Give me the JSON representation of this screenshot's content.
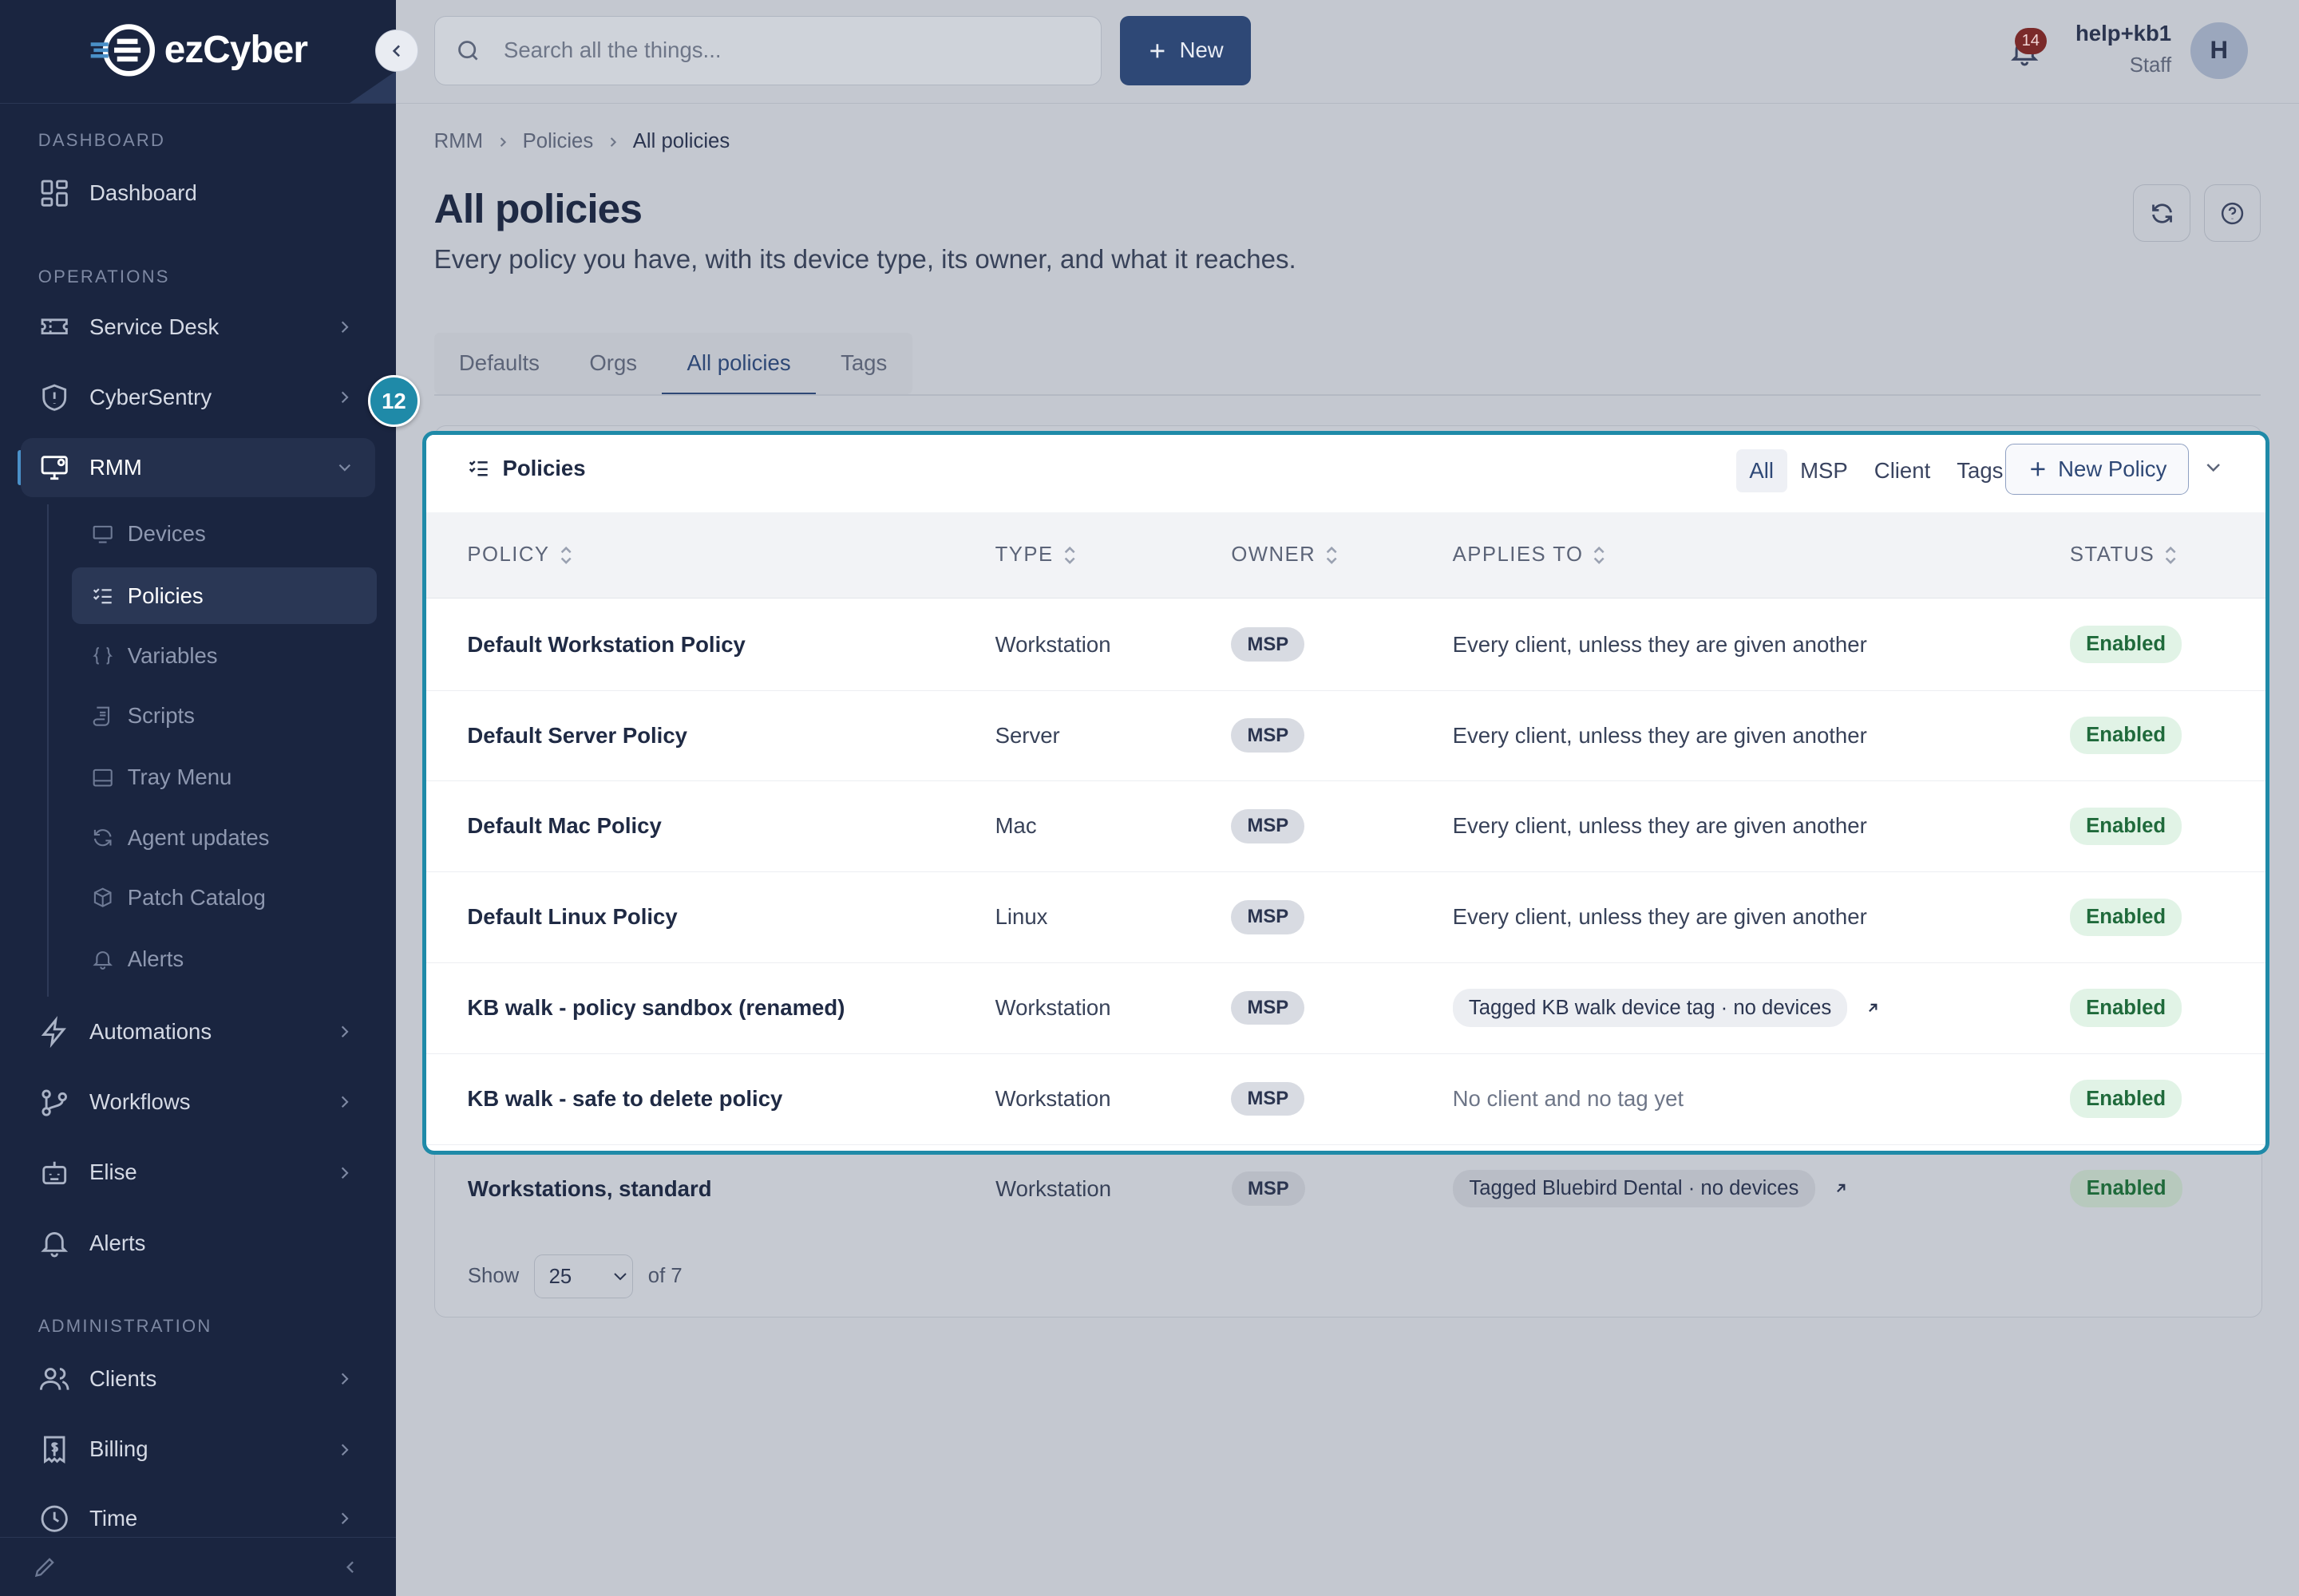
{
  "brand": {
    "logo_text": "ezCyber"
  },
  "sidebar": {
    "sections": {
      "dashboard": "DASHBOARD",
      "operations": "OPERATIONS",
      "administration": "ADMINISTRATION"
    },
    "items": {
      "dashboard": "Dashboard",
      "service_desk": "Service Desk",
      "cybersentry": "CyberSentry",
      "rmm": "RMM",
      "automations": "Automations",
      "workflows": "Workflows",
      "elise": "Elise",
      "alerts": "Alerts",
      "clients": "Clients",
      "billing": "Billing",
      "time": "Time"
    },
    "rmm_sub": {
      "devices": "Devices",
      "policies": "Policies",
      "variables": "Variables",
      "scripts": "Scripts",
      "tray_menu": "Tray Menu",
      "agent_updates": "Agent updates",
      "patch_catalog": "Patch Catalog",
      "alerts": "Alerts"
    }
  },
  "topbar": {
    "search_placeholder": "Search all the things...",
    "new_label": "New",
    "notifications_count": "14",
    "user_name": "help+kb1",
    "user_role": "Staff",
    "avatar_initial": "H"
  },
  "breadcrumb": {
    "a": "RMM",
    "b": "Policies",
    "c": "All policies"
  },
  "page": {
    "title": "All policies",
    "subtitle": "Every policy you have, with its device type, its owner, and what it reaches."
  },
  "tabs": {
    "defaults": "Defaults",
    "orgs": "Orgs",
    "all_policies": "All policies",
    "tags": "Tags"
  },
  "step_badge": "12",
  "card": {
    "title": "Policies",
    "filters": {
      "all": "All",
      "msp": "MSP",
      "client": "Client",
      "tags": "Tags"
    },
    "new_policy": "New Policy",
    "columns": {
      "policy": "POLICY",
      "type": "TYPE",
      "owner": "OWNER",
      "applies_to": "APPLIES TO",
      "status": "STATUS"
    },
    "rows": [
      {
        "policy": "Default Workstation Policy",
        "type": "Workstation",
        "owner": "MSP",
        "applies": "Every client, unless they are given another",
        "status": "Enabled"
      },
      {
        "policy": "Default Server Policy",
        "type": "Server",
        "owner": "MSP",
        "applies": "Every client, unless they are given another",
        "status": "Enabled"
      },
      {
        "policy": "Default Mac Policy",
        "type": "Mac",
        "owner": "MSP",
        "applies": "Every client, unless they are given another",
        "status": "Enabled"
      },
      {
        "policy": "Default Linux Policy",
        "type": "Linux",
        "owner": "MSP",
        "applies": "Every client, unless they are given another",
        "status": "Enabled"
      },
      {
        "policy": "KB walk - policy sandbox (renamed)",
        "type": "Workstation",
        "owner": "MSP",
        "applies": "Tagged KB walk device tag · no devices",
        "status": "Enabled"
      },
      {
        "policy": "KB walk - safe to delete policy",
        "type": "Workstation",
        "owner": "MSP",
        "applies": "No client and no tag yet",
        "status": "Enabled"
      },
      {
        "policy": "Workstations, standard",
        "type": "Workstation",
        "owner": "MSP",
        "applies": "Tagged Bluebird Dental · no devices",
        "status": "Enabled"
      }
    ],
    "pager": {
      "show_label": "Show",
      "page_size": "25",
      "of_label": "of 7"
    }
  },
  "colors": {
    "sidebar_bg": "#1a2540",
    "accent": "#2e4876",
    "highlight": "#1f8aa8",
    "enabled_text": "#1f6a3b"
  }
}
